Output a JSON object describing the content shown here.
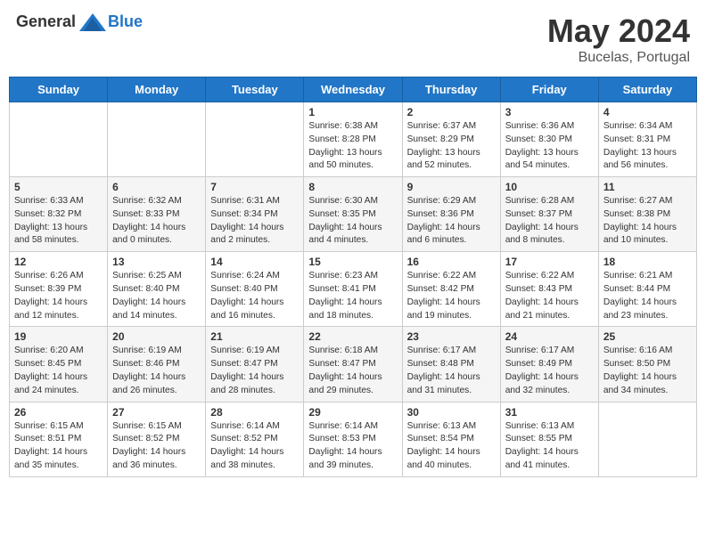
{
  "header": {
    "logo_general": "General",
    "logo_blue": "Blue",
    "title": "May 2024",
    "location": "Bucelas, Portugal"
  },
  "days_of_week": [
    "Sunday",
    "Monday",
    "Tuesday",
    "Wednesday",
    "Thursday",
    "Friday",
    "Saturday"
  ],
  "weeks": [
    [
      {
        "day": "",
        "sunrise": "",
        "sunset": "",
        "daylight": ""
      },
      {
        "day": "",
        "sunrise": "",
        "sunset": "",
        "daylight": ""
      },
      {
        "day": "",
        "sunrise": "",
        "sunset": "",
        "daylight": ""
      },
      {
        "day": "1",
        "sunrise": "Sunrise: 6:38 AM",
        "sunset": "Sunset: 8:28 PM",
        "daylight": "Daylight: 13 hours and 50 minutes."
      },
      {
        "day": "2",
        "sunrise": "Sunrise: 6:37 AM",
        "sunset": "Sunset: 8:29 PM",
        "daylight": "Daylight: 13 hours and 52 minutes."
      },
      {
        "day": "3",
        "sunrise": "Sunrise: 6:36 AM",
        "sunset": "Sunset: 8:30 PM",
        "daylight": "Daylight: 13 hours and 54 minutes."
      },
      {
        "day": "4",
        "sunrise": "Sunrise: 6:34 AM",
        "sunset": "Sunset: 8:31 PM",
        "daylight": "Daylight: 13 hours and 56 minutes."
      }
    ],
    [
      {
        "day": "5",
        "sunrise": "Sunrise: 6:33 AM",
        "sunset": "Sunset: 8:32 PM",
        "daylight": "Daylight: 13 hours and 58 minutes."
      },
      {
        "day": "6",
        "sunrise": "Sunrise: 6:32 AM",
        "sunset": "Sunset: 8:33 PM",
        "daylight": "Daylight: 14 hours and 0 minutes."
      },
      {
        "day": "7",
        "sunrise": "Sunrise: 6:31 AM",
        "sunset": "Sunset: 8:34 PM",
        "daylight": "Daylight: 14 hours and 2 minutes."
      },
      {
        "day": "8",
        "sunrise": "Sunrise: 6:30 AM",
        "sunset": "Sunset: 8:35 PM",
        "daylight": "Daylight: 14 hours and 4 minutes."
      },
      {
        "day": "9",
        "sunrise": "Sunrise: 6:29 AM",
        "sunset": "Sunset: 8:36 PM",
        "daylight": "Daylight: 14 hours and 6 minutes."
      },
      {
        "day": "10",
        "sunrise": "Sunrise: 6:28 AM",
        "sunset": "Sunset: 8:37 PM",
        "daylight": "Daylight: 14 hours and 8 minutes."
      },
      {
        "day": "11",
        "sunrise": "Sunrise: 6:27 AM",
        "sunset": "Sunset: 8:38 PM",
        "daylight": "Daylight: 14 hours and 10 minutes."
      }
    ],
    [
      {
        "day": "12",
        "sunrise": "Sunrise: 6:26 AM",
        "sunset": "Sunset: 8:39 PM",
        "daylight": "Daylight: 14 hours and 12 minutes."
      },
      {
        "day": "13",
        "sunrise": "Sunrise: 6:25 AM",
        "sunset": "Sunset: 8:40 PM",
        "daylight": "Daylight: 14 hours and 14 minutes."
      },
      {
        "day": "14",
        "sunrise": "Sunrise: 6:24 AM",
        "sunset": "Sunset: 8:40 PM",
        "daylight": "Daylight: 14 hours and 16 minutes."
      },
      {
        "day": "15",
        "sunrise": "Sunrise: 6:23 AM",
        "sunset": "Sunset: 8:41 PM",
        "daylight": "Daylight: 14 hours and 18 minutes."
      },
      {
        "day": "16",
        "sunrise": "Sunrise: 6:22 AM",
        "sunset": "Sunset: 8:42 PM",
        "daylight": "Daylight: 14 hours and 19 minutes."
      },
      {
        "day": "17",
        "sunrise": "Sunrise: 6:22 AM",
        "sunset": "Sunset: 8:43 PM",
        "daylight": "Daylight: 14 hours and 21 minutes."
      },
      {
        "day": "18",
        "sunrise": "Sunrise: 6:21 AM",
        "sunset": "Sunset: 8:44 PM",
        "daylight": "Daylight: 14 hours and 23 minutes."
      }
    ],
    [
      {
        "day": "19",
        "sunrise": "Sunrise: 6:20 AM",
        "sunset": "Sunset: 8:45 PM",
        "daylight": "Daylight: 14 hours and 24 minutes."
      },
      {
        "day": "20",
        "sunrise": "Sunrise: 6:19 AM",
        "sunset": "Sunset: 8:46 PM",
        "daylight": "Daylight: 14 hours and 26 minutes."
      },
      {
        "day": "21",
        "sunrise": "Sunrise: 6:19 AM",
        "sunset": "Sunset: 8:47 PM",
        "daylight": "Daylight: 14 hours and 28 minutes."
      },
      {
        "day": "22",
        "sunrise": "Sunrise: 6:18 AM",
        "sunset": "Sunset: 8:47 PM",
        "daylight": "Daylight: 14 hours and 29 minutes."
      },
      {
        "day": "23",
        "sunrise": "Sunrise: 6:17 AM",
        "sunset": "Sunset: 8:48 PM",
        "daylight": "Daylight: 14 hours and 31 minutes."
      },
      {
        "day": "24",
        "sunrise": "Sunrise: 6:17 AM",
        "sunset": "Sunset: 8:49 PM",
        "daylight": "Daylight: 14 hours and 32 minutes."
      },
      {
        "day": "25",
        "sunrise": "Sunrise: 6:16 AM",
        "sunset": "Sunset: 8:50 PM",
        "daylight": "Daylight: 14 hours and 34 minutes."
      }
    ],
    [
      {
        "day": "26",
        "sunrise": "Sunrise: 6:15 AM",
        "sunset": "Sunset: 8:51 PM",
        "daylight": "Daylight: 14 hours and 35 minutes."
      },
      {
        "day": "27",
        "sunrise": "Sunrise: 6:15 AM",
        "sunset": "Sunset: 8:52 PM",
        "daylight": "Daylight: 14 hours and 36 minutes."
      },
      {
        "day": "28",
        "sunrise": "Sunrise: 6:14 AM",
        "sunset": "Sunset: 8:52 PM",
        "daylight": "Daylight: 14 hours and 38 minutes."
      },
      {
        "day": "29",
        "sunrise": "Sunrise: 6:14 AM",
        "sunset": "Sunset: 8:53 PM",
        "daylight": "Daylight: 14 hours and 39 minutes."
      },
      {
        "day": "30",
        "sunrise": "Sunrise: 6:13 AM",
        "sunset": "Sunset: 8:54 PM",
        "daylight": "Daylight: 14 hours and 40 minutes."
      },
      {
        "day": "31",
        "sunrise": "Sunrise: 6:13 AM",
        "sunset": "Sunset: 8:55 PM",
        "daylight": "Daylight: 14 hours and 41 minutes."
      },
      {
        "day": "",
        "sunrise": "",
        "sunset": "",
        "daylight": ""
      }
    ]
  ]
}
